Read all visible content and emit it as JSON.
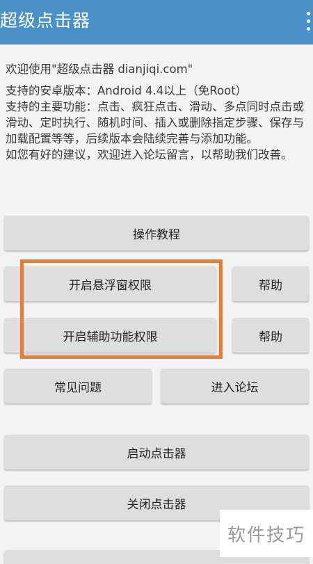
{
  "appbar": {
    "title": "超级点击器",
    "menu_icon": "more-vert-icon",
    "color": "#4a90c9"
  },
  "intro": {
    "welcome": "欢迎使用\"超级点击器 dianjiqi.com\"",
    "versions": "支持的安卓版本：Android 4.4以上（免Root）",
    "features": "支持的主要功能：点击、疯狂点击、滑动、多点同时点击或滑动、定时执行、随机时间、插入或删除指定步骤、保存与加载配置等等，后续版本会陆续完善与添加功能。",
    "feedback": "如您有好的建议，欢迎进入论坛留言，以帮助我们改善。"
  },
  "buttons": {
    "tutorial": "操作教程",
    "overlay_permission": "开启悬浮窗权限",
    "overlay_help": "帮助",
    "accessibility_permission": "开启辅助功能权限",
    "accessibility_help": "帮助",
    "faq": "常见问题",
    "forum": "进入论坛",
    "start_clicker": "启动点击器",
    "stop_clicker": "关闭点击器"
  },
  "highlight_color": "#f07b2a",
  "watermark": "软件技巧"
}
